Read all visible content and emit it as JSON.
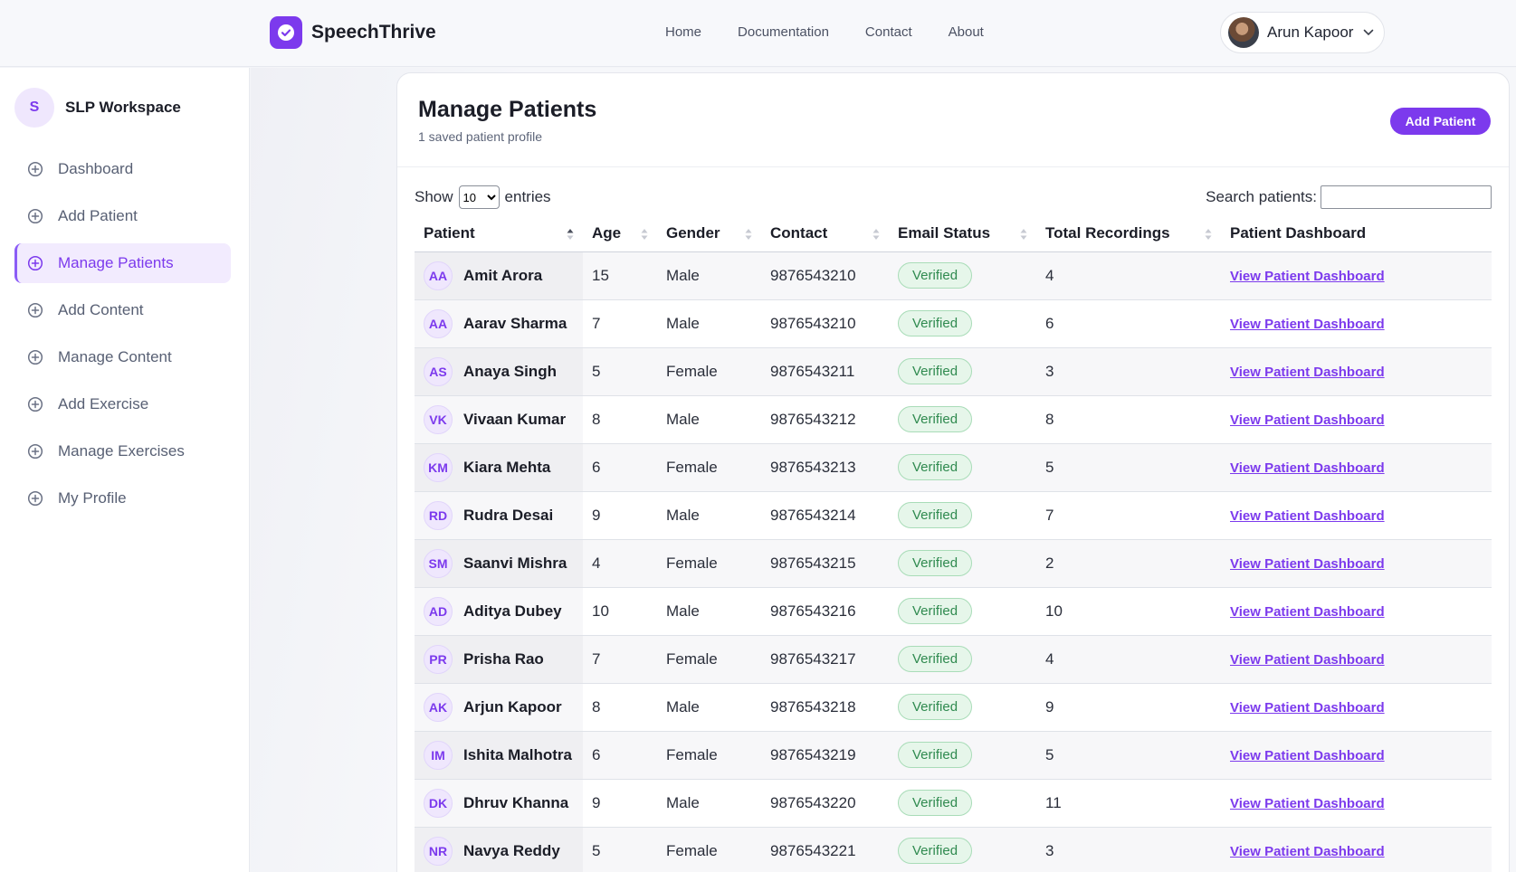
{
  "brand": {
    "name": "SpeechThrive",
    "logo_icon": "check-circle-icon",
    "accent": "#7c3aed"
  },
  "nav": [
    "Home",
    "Documentation",
    "Contact",
    "About"
  ],
  "user": {
    "name": "Arun Kapoor"
  },
  "workspace": {
    "initial": "S",
    "name": "SLP Workspace"
  },
  "sidebar": {
    "items": [
      {
        "label": "Dashboard",
        "active": false
      },
      {
        "label": "Add Patient",
        "active": false
      },
      {
        "label": "Manage Patients",
        "active": true
      },
      {
        "label": "Add Content",
        "active": false
      },
      {
        "label": "Manage Content",
        "active": false
      },
      {
        "label": "Add Exercise",
        "active": false
      },
      {
        "label": "Manage Exercises",
        "active": false
      },
      {
        "label": "My Profile",
        "active": false
      }
    ]
  },
  "page": {
    "title": "Manage Patients",
    "subtitle": "1 saved patient profile",
    "add_button": "Add Patient"
  },
  "controls": {
    "show_label": "Show",
    "entries_value": "10",
    "entries_label": "entries",
    "search_label": "Search patients:",
    "search_value": ""
  },
  "table": {
    "columns": [
      "Patient",
      "Age",
      "Gender",
      "Contact",
      "Email Status",
      "Total Recordings",
      "Patient Dashboard"
    ],
    "rows": [
      {
        "initials": "AA",
        "name": "Amit Arora",
        "age": "15",
        "gender": "Male",
        "contact": "9876543210",
        "status": "Verified",
        "recordings": "4",
        "link": "View Patient Dashboard"
      },
      {
        "initials": "AA",
        "name": "Aarav Sharma",
        "age": "7",
        "gender": "Male",
        "contact": "9876543210",
        "status": "Verified",
        "recordings": "6",
        "link": "View Patient Dashboard"
      },
      {
        "initials": "AS",
        "name": "Anaya Singh",
        "age": "5",
        "gender": "Female",
        "contact": "9876543211",
        "status": "Verified",
        "recordings": "3",
        "link": "View Patient Dashboard"
      },
      {
        "initials": "VK",
        "name": "Vivaan Kumar",
        "age": "8",
        "gender": "Male",
        "contact": "9876543212",
        "status": "Verified",
        "recordings": "8",
        "link": "View Patient Dashboard"
      },
      {
        "initials": "KM",
        "name": "Kiara Mehta",
        "age": "6",
        "gender": "Female",
        "contact": "9876543213",
        "status": "Verified",
        "recordings": "5",
        "link": "View Patient Dashboard"
      },
      {
        "initials": "RD",
        "name": "Rudra Desai",
        "age": "9",
        "gender": "Male",
        "contact": "9876543214",
        "status": "Verified",
        "recordings": "7",
        "link": "View Patient Dashboard"
      },
      {
        "initials": "SM",
        "name": "Saanvi Mishra",
        "age": "4",
        "gender": "Female",
        "contact": "9876543215",
        "status": "Verified",
        "recordings": "2",
        "link": "View Patient Dashboard"
      },
      {
        "initials": "AD",
        "name": "Aditya Dubey",
        "age": "10",
        "gender": "Male",
        "contact": "9876543216",
        "status": "Verified",
        "recordings": "10",
        "link": "View Patient Dashboard"
      },
      {
        "initials": "PR",
        "name": "Prisha Rao",
        "age": "7",
        "gender": "Female",
        "contact": "9876543217",
        "status": "Verified",
        "recordings": "4",
        "link": "View Patient Dashboard"
      },
      {
        "initials": "AK",
        "name": "Arjun Kapoor",
        "age": "8",
        "gender": "Male",
        "contact": "9876543218",
        "status": "Verified",
        "recordings": "9",
        "link": "View Patient Dashboard"
      },
      {
        "initials": "IM",
        "name": "Ishita Malhotra",
        "age": "6",
        "gender": "Female",
        "contact": "9876543219",
        "status": "Verified",
        "recordings": "5",
        "link": "View Patient Dashboard"
      },
      {
        "initials": "DK",
        "name": "Dhruv Khanna",
        "age": "9",
        "gender": "Male",
        "contact": "9876543220",
        "status": "Verified",
        "recordings": "11",
        "link": "View Patient Dashboard"
      },
      {
        "initials": "NR",
        "name": "Navya Reddy",
        "age": "5",
        "gender": "Female",
        "contact": "9876543221",
        "status": "Verified",
        "recordings": "3",
        "link": "View Patient Dashboard"
      }
    ]
  }
}
